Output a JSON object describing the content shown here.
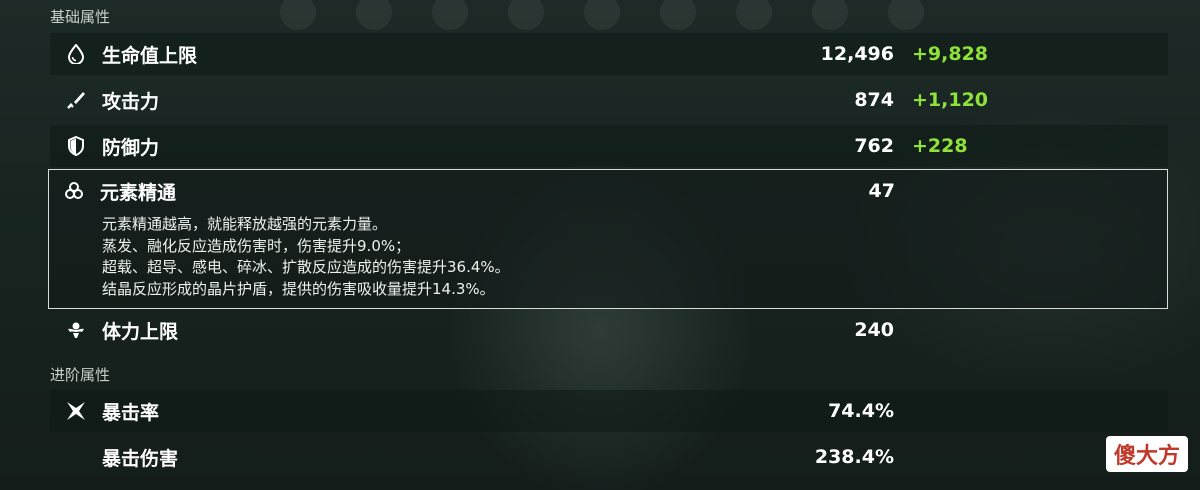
{
  "sections": {
    "basic": "基础属性",
    "advanced": "进阶属性"
  },
  "stats": {
    "hp": {
      "label": "生命值上限",
      "base": "12,496",
      "bonus": "+9,828",
      "icon": "droplet-icon"
    },
    "atk": {
      "label": "攻击力",
      "base": "874",
      "bonus": "+1,120",
      "icon": "sword-icon"
    },
    "def": {
      "label": "防御力",
      "base": "762",
      "bonus": "+228",
      "icon": "shield-icon"
    },
    "em": {
      "label": "元素精通",
      "base": "47",
      "icon": "elemental-mastery-icon",
      "desc": [
        "元素精通越高，就能释放越强的元素力量。",
        "蒸发、融化反应造成伤害时，伤害提升9.0%；",
        "超载、超导、感电、碎冰、扩散反应造成的伤害提升36.4%。",
        "结晶反应形成的晶片护盾，提供的伤害吸收量提升14.3%。"
      ]
    },
    "stamina": {
      "label": "体力上限",
      "base": "240",
      "icon": "stamina-icon"
    },
    "crit_rate": {
      "label": "暴击率",
      "base": "74.4%",
      "icon": "crit-star-icon"
    },
    "crit_dmg": {
      "label": "暴击伤害",
      "base": "238.4%"
    }
  },
  "watermark": "傻大方",
  "colors": {
    "bonus": "#8ee23a",
    "text": "#ffffff",
    "border": "#d9dcd8"
  }
}
